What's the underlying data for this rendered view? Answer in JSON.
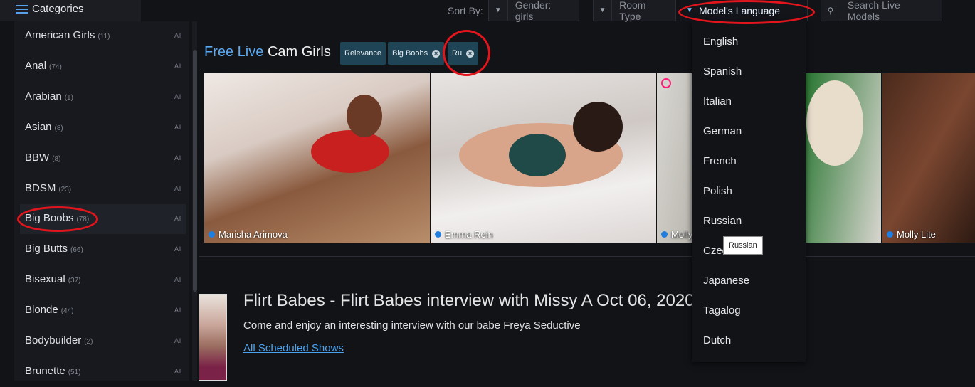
{
  "header": {
    "categories_label": "Categories",
    "sort_by_label": "Sort By:",
    "gender_label": "Gender: girls",
    "room_type_label": "Room Type",
    "language_label": "Model's Language",
    "search_placeholder": "Search Live Models"
  },
  "sidebar": {
    "items": [
      {
        "label": "American Girls",
        "count": "(11)",
        "all": "All"
      },
      {
        "label": "Anal",
        "count": "(74)",
        "all": "All"
      },
      {
        "label": "Arabian",
        "count": "(1)",
        "all": "All"
      },
      {
        "label": "Asian",
        "count": "(8)",
        "all": "All"
      },
      {
        "label": "BBW",
        "count": "(8)",
        "all": "All"
      },
      {
        "label": "BDSM",
        "count": "(23)",
        "all": "All"
      },
      {
        "label": "Big Boobs",
        "count": "(78)",
        "all": "All"
      },
      {
        "label": "Big Butts",
        "count": "(66)",
        "all": "All"
      },
      {
        "label": "Bisexual",
        "count": "(37)",
        "all": "All"
      },
      {
        "label": "Blonde",
        "count": "(44)",
        "all": "All"
      },
      {
        "label": "Bodybuilder",
        "count": "(2)",
        "all": "All"
      },
      {
        "label": "Brunette",
        "count": "(51)",
        "all": "All"
      }
    ]
  },
  "main": {
    "title_blue": "Free Live",
    "title_white": "Cam Girls",
    "chips": [
      {
        "label": "Relevance"
      },
      {
        "label": "Big Boobs"
      },
      {
        "label": "Ru"
      }
    ],
    "models": [
      {
        "name": "Marisha Arimova"
      },
      {
        "name": "Emma Rein"
      },
      {
        "name": "Molly"
      },
      {
        "name": "Molly Lite"
      }
    ],
    "show": {
      "title": "Flirt Babes - Flirt Babes interview with Missy A Oct 06, 2020 (",
      "description": "Come and enjoy an interesting interview with our babe Freya Seductive",
      "link": "All Scheduled Shows"
    }
  },
  "language_dropdown": {
    "options": [
      "English",
      "Spanish",
      "Italian",
      "German",
      "French",
      "Polish",
      "Russian",
      "Czech",
      "Japanese",
      "Tagalog",
      "Dutch"
    ],
    "tooltip": "Russian"
  },
  "colors": {
    "accent": "#5aa9f2",
    "annotation": "#e3151c",
    "chip": "#1f4456"
  }
}
